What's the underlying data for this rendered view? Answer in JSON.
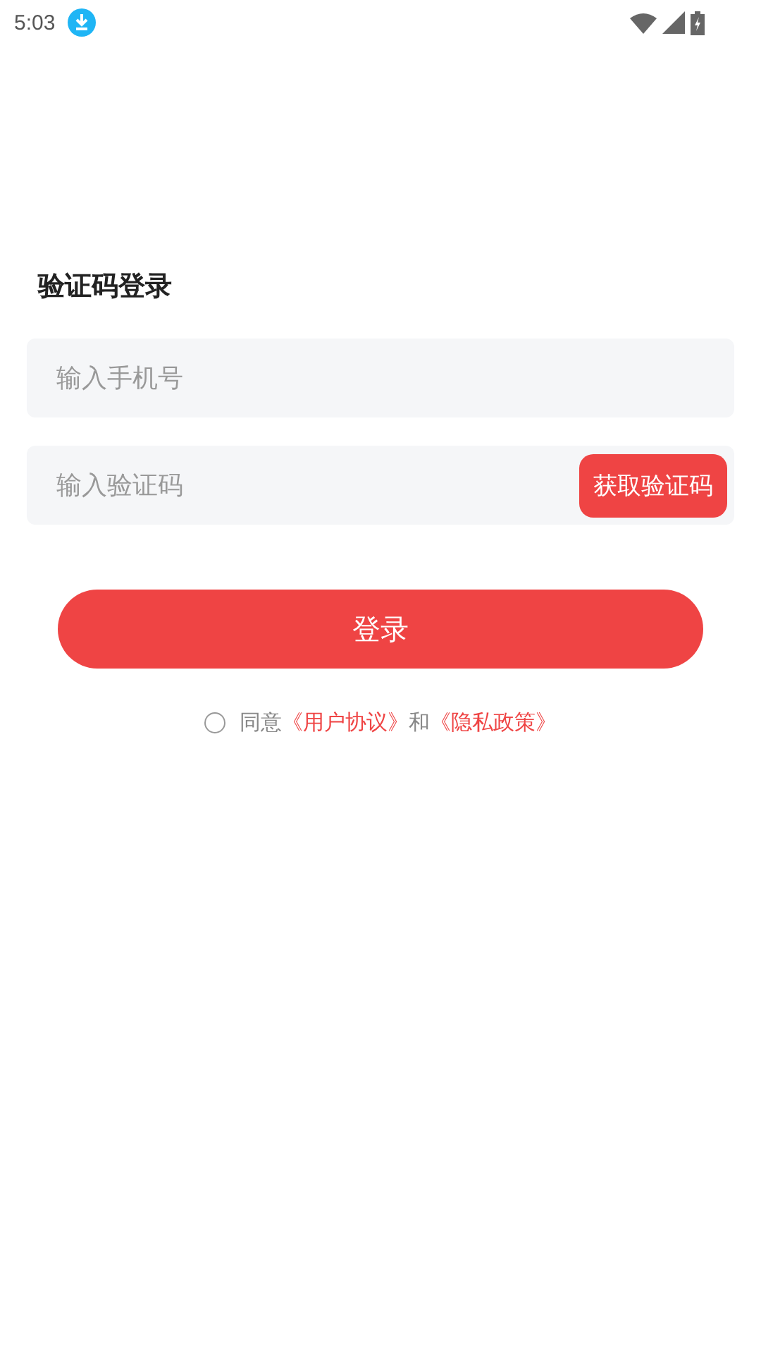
{
  "status_bar": {
    "time": "5:03"
  },
  "title": "验证码登录",
  "phone_field": {
    "placeholder": "输入手机号"
  },
  "code_field": {
    "placeholder": "输入验证码"
  },
  "get_code_button": "获取验证码",
  "login_button": "登录",
  "agreement": {
    "checked": false,
    "parts": [
      {
        "kind": "text",
        "text": "同意"
      },
      {
        "kind": "link",
        "text": "《用户协议》"
      },
      {
        "kind": "text",
        "text": "和"
      },
      {
        "kind": "link",
        "text": "《隐私政策》"
      }
    ]
  }
}
